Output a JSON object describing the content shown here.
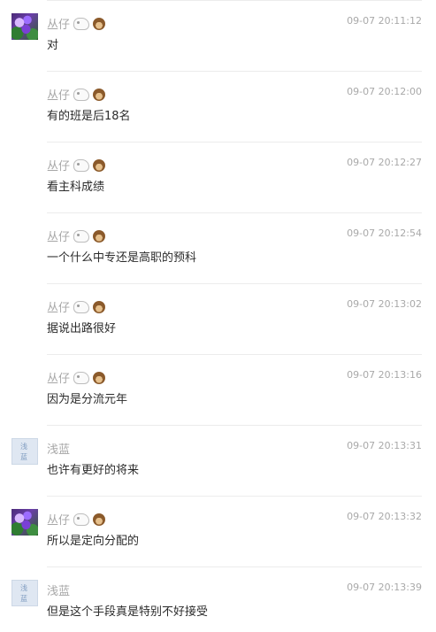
{
  "messages": [
    {
      "avatar": "flower-avatar",
      "name": "丛仔",
      "emojis": [
        "dog-icon",
        "monkey-icon"
      ],
      "time": "09-07 20:11:12",
      "text": "对"
    },
    {
      "avatar": "",
      "name": "丛仔",
      "emojis": [
        "dog-icon",
        "monkey-icon"
      ],
      "time": "09-07 20:12:00",
      "text": "有的班是后18名"
    },
    {
      "avatar": "",
      "name": "丛仔",
      "emojis": [
        "dog-icon",
        "monkey-icon"
      ],
      "time": "09-07 20:12:27",
      "text": "看主科成绩"
    },
    {
      "avatar": "",
      "name": "丛仔",
      "emojis": [
        "dog-icon",
        "monkey-icon"
      ],
      "time": "09-07 20:12:54",
      "text": "一个什么中专还是高职的预科"
    },
    {
      "avatar": "",
      "name": "丛仔",
      "emojis": [
        "dog-icon",
        "monkey-icon"
      ],
      "time": "09-07 20:13:02",
      "text": "据说出路很好"
    },
    {
      "avatar": "",
      "name": "丛仔",
      "emojis": [
        "dog-icon",
        "monkey-icon"
      ],
      "time": "09-07 20:13:16",
      "text": "因为是分流元年"
    },
    {
      "avatar": "blue-avatar",
      "name": "浅蓝",
      "emojis": [],
      "time": "09-07 20:13:31",
      "text": "也许有更好的将来"
    },
    {
      "avatar": "flower-avatar",
      "name": "丛仔",
      "emojis": [
        "dog-icon",
        "monkey-icon"
      ],
      "time": "09-07 20:13:32",
      "text": "所以是定向分配的"
    },
    {
      "avatar": "blue-avatar",
      "name": "浅蓝",
      "emojis": [],
      "time": "09-07 20:13:39",
      "text": "但是这个手段真是特别不好接受"
    }
  ]
}
